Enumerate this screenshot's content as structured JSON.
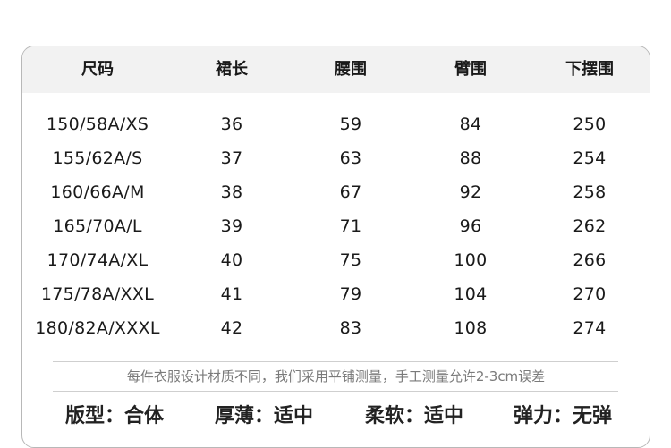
{
  "table": {
    "headers": [
      "尺码",
      "裙长",
      "腰围",
      "臂围",
      "下摆围"
    ],
    "rows": [
      [
        "150/58A/XS",
        "36",
        "59",
        "84",
        "250"
      ],
      [
        "155/62A/S",
        "37",
        "63",
        "88",
        "254"
      ],
      [
        "160/66A/M",
        "38",
        "67",
        "92",
        "258"
      ],
      [
        "165/70A/L",
        "39",
        "71",
        "96",
        "262"
      ],
      [
        "170/74A/XL",
        "40",
        "75",
        "100",
        "266"
      ],
      [
        "175/78A/XXL",
        "41",
        "79",
        "104",
        "270"
      ],
      [
        "180/82A/XXXL",
        "42",
        "83",
        "108",
        "274"
      ]
    ]
  },
  "note": "每件衣服设计材质不同，我们采用平铺测量，手工测量允许2-3cm误差",
  "specs": [
    "版型：合体",
    "厚薄：适中",
    "柔软：适中",
    "弹力：无弹"
  ]
}
